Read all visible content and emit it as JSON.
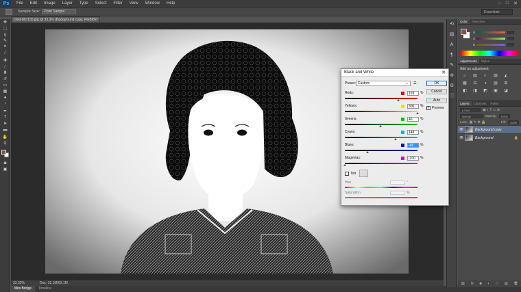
{
  "app": {
    "logo": "Ps",
    "menu": [
      "File",
      "Edit",
      "Image",
      "Layer",
      "Type",
      "Select",
      "Filter",
      "View",
      "Window",
      "Help"
    ],
    "window_controls": [
      "–",
      "□",
      "✕"
    ]
  },
  "options_bar": {
    "sample_size_label": "Sample Size:",
    "sample_size_value": "Point Sample",
    "workspace": "Essentials"
  },
  "document": {
    "tab_title": "child-807155.jpg @ 33.3% (Background copy, RGB/8#) *",
    "zoom": "33.33%",
    "doc_info": "Doc: 31.1M/62.1M"
  },
  "bottom_tabs": [
    "Mini Bridge",
    "Timeline"
  ],
  "panels": {
    "color_tabs": [
      "Color",
      "Swatches"
    ],
    "color_fg": "#7a5a46",
    "adjust_tabs": [
      "Adjustments",
      "Styles"
    ],
    "adjust_title": "Add an adjustment",
    "adjust_icons": [
      "☼",
      "▥",
      "◐",
      "▨",
      "◭",
      "▦",
      "⚖",
      "◑",
      "▤",
      "⊞",
      "◧",
      "◨",
      "◩",
      "▣",
      "◪"
    ],
    "layers_tabs": [
      "Layers",
      "Channels",
      "Paths"
    ],
    "blend_mode": "Normal",
    "opacity_label": "Opacity:",
    "opacity": "100%",
    "lock_label": "Lock:",
    "fill_label": "Fill:",
    "fill": "100%",
    "layers": [
      {
        "name": "Background copy",
        "selected": true
      },
      {
        "name": "Background",
        "selected": false
      }
    ],
    "footer_icons": [
      "⛓",
      "fx",
      "◙",
      "◐",
      "▭",
      "▤",
      "🗑"
    ]
  },
  "dialog": {
    "title": "Black and White",
    "preset_label": "Preset:",
    "preset_value": "Custom",
    "ok": "OK",
    "cancel": "Cancel",
    "auto": "Auto",
    "preview": "Preview",
    "percent": "%",
    "channels": [
      {
        "label": "Reds:",
        "value": "169",
        "color": "#e00000",
        "bar": "linear-gradient(90deg,#000,#e00000)"
      },
      {
        "label": "Yellows:",
        "value": "300",
        "color": "#f0e000",
        "bar": "linear-gradient(90deg,#000,#f0e000)"
      },
      {
        "label": "Greens:",
        "value": "46",
        "color": "#00c000",
        "bar": "linear-gradient(90deg,#000,#00c000)"
      },
      {
        "label": "Cyans:",
        "value": "148",
        "color": "#00b0e0",
        "bar": "linear-gradient(90deg,#000,#00b0e0)"
      },
      {
        "label": "Blues:",
        "value": "-45",
        "color": "#0000c0",
        "bar": "linear-gradient(90deg,#000,#0000c0)",
        "focus": true
      },
      {
        "label": "Magentas:",
        "value": "-200",
        "color": "#d000c0",
        "bar": "linear-gradient(90deg,#000,#d000c0)"
      }
    ],
    "tint_label": "Tint",
    "hue_label": "Hue",
    "hue_unit": "°",
    "saturation_label": "Saturation",
    "saturation_unit": "%"
  }
}
